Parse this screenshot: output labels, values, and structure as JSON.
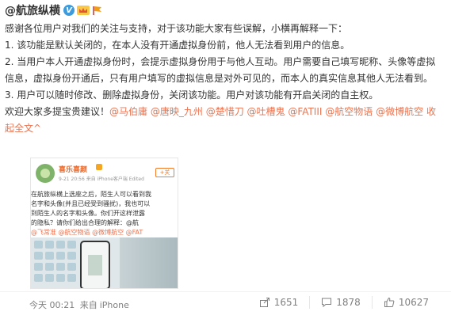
{
  "post": {
    "author": "@航旅纵横",
    "verified_badge": "V",
    "paragraphs": [
      "感谢各位用户对我们的关注与支持，对于该功能大家有些误解，小横再解释一下：",
      "1. 该功能是默认关闭的，在本人没有开通虚拟身份前，他人无法看到用户的信息。",
      "2. 当用户本人开通虚拟身份时，会提示虚拟身份用于与他人互动。用户需要自己填写昵称、头像等虚拟信息，虚拟身份开通后，只有用户填写的虚拟信息是对外可见的，而本人的真实信息其他人无法看到。",
      "3. 用户可以随时修改、删除虚拟身份，关闭该功能。用户对该功能有开启关闭的自主权。"
    ],
    "suggestion_prefix": "欢迎大家多提宝贵建议！",
    "mentions": [
      "@马伯庸",
      "@唐映_九州",
      "@楚惜刀",
      "@吐槽鬼",
      "@FATIII",
      "@航空物语",
      "@微博航空"
    ],
    "collapse_label": "收起全文",
    "collapse_arrow": "^"
  },
  "embed": {
    "name": "喜乐喜颜",
    "meta": "9-21 20:56  来自 iPhone客户端  Edited",
    "follow": "+关",
    "lines": [
      "在航旅纵横上选座之后，陌生人可以看到我",
      "名字和头像(并且已经受到骚扰)，我也可以",
      "到陌生人的名字和头像。你们开这样泄露",
      "的隐私？请你们给出合理的解释：@航",
      "@飞常准 @航空物语 @微博航空 @FAT"
    ],
    "line_mentions": [
      "@航",
      "@飞常准",
      "@航空物语",
      "@微博航空",
      "@FAT"
    ]
  },
  "footer": {
    "time": "今天 00:21",
    "source_prefix": "来自",
    "source": "iPhone",
    "share_count": "1651",
    "comment_count": "1878",
    "like_count": "10627"
  },
  "icons": {
    "share": "share-icon",
    "comment": "comment-icon",
    "like": "like-icon"
  },
  "colors": {
    "accent": "#eb7350",
    "text": "#333333",
    "muted": "#808080",
    "verified": "#3d9bdc"
  }
}
